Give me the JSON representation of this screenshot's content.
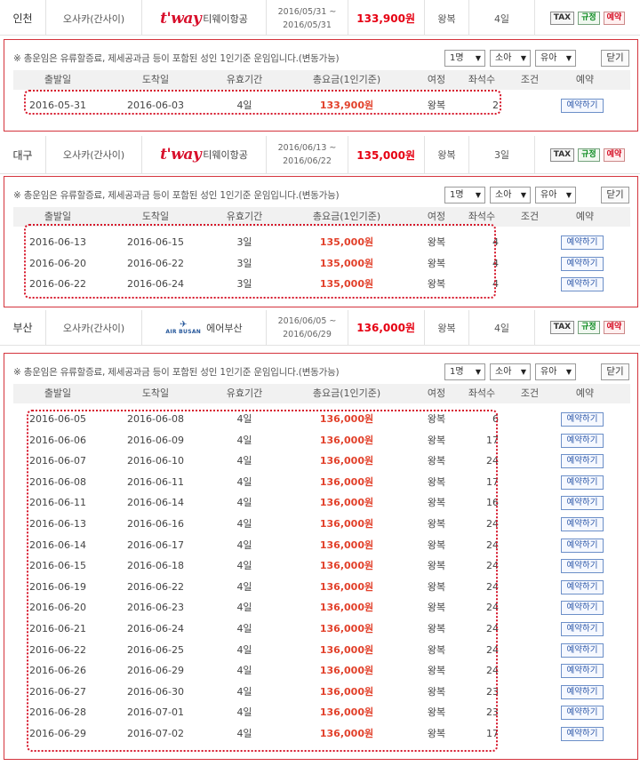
{
  "common": {
    "notice": "※ 총운임은 유류할증료, 제세공과금 등이 포함된 성인 1인기준 운임입니다.(변동가능)",
    "select_adult": "1명",
    "select_child": "소아",
    "select_infant": "유아",
    "close_label": "닫기",
    "headers": [
      "출발일",
      "도착일",
      "유효기간",
      "총요금(1인기준)",
      "여정",
      "좌석수",
      "조건",
      "예약"
    ],
    "reserve_label": "예약하기",
    "badge_tax": "TAX",
    "badge_rule": "규정",
    "badge_book": "예약",
    "select_arrow": "▼"
  },
  "groups": [
    {
      "summary": {
        "city": "인천",
        "destination": "오사카(간사이)",
        "logo_text": "t'way",
        "airline": "티웨이항공",
        "period_start": "2016/05/31 ~",
        "period_end": "2016/05/31",
        "price": "133,900원",
        "trip": "왕복",
        "stay": "4일"
      },
      "rows": [
        [
          "2016-05-31",
          "2016-06-03",
          "4일",
          "133,900원",
          "왕복",
          "2"
        ]
      ]
    },
    {
      "summary": {
        "city": "대구",
        "destination": "오사카(간사이)",
        "logo_text": "t'way",
        "airline": "티웨이항공",
        "period_start": "2016/06/13 ~",
        "period_end": "2016/06/22",
        "price": "135,000원",
        "trip": "왕복",
        "stay": "3일"
      },
      "rows": [
        [
          "2016-06-13",
          "2016-06-15",
          "3일",
          "135,000원",
          "왕복",
          "4"
        ],
        [
          "2016-06-20",
          "2016-06-22",
          "3일",
          "135,000원",
          "왕복",
          "4"
        ],
        [
          "2016-06-22",
          "2016-06-24",
          "3일",
          "135,000원",
          "왕복",
          "4"
        ]
      ]
    },
    {
      "summary": {
        "city": "부산",
        "destination": "오사카(간사이)",
        "logo_text": "AIR BUSAN",
        "airline": "에어부산",
        "period_start": "2016/06/05 ~",
        "period_end": "2016/06/29",
        "price": "136,000원",
        "trip": "왕복",
        "stay": "4일"
      },
      "rows": [
        [
          "2016-06-05",
          "2016-06-08",
          "4일",
          "136,000원",
          "왕복",
          "6"
        ],
        [
          "2016-06-06",
          "2016-06-09",
          "4일",
          "136,000원",
          "왕복",
          "17"
        ],
        [
          "2016-06-07",
          "2016-06-10",
          "4일",
          "136,000원",
          "왕복",
          "24"
        ],
        [
          "2016-06-08",
          "2016-06-11",
          "4일",
          "136,000원",
          "왕복",
          "17"
        ],
        [
          "2016-06-11",
          "2016-06-14",
          "4일",
          "136,000원",
          "왕복",
          "16"
        ],
        [
          "2016-06-13",
          "2016-06-16",
          "4일",
          "136,000원",
          "왕복",
          "24"
        ],
        [
          "2016-06-14",
          "2016-06-17",
          "4일",
          "136,000원",
          "왕복",
          "24"
        ],
        [
          "2016-06-15",
          "2016-06-18",
          "4일",
          "136,000원",
          "왕복",
          "24"
        ],
        [
          "2016-06-19",
          "2016-06-22",
          "4일",
          "136,000원",
          "왕복",
          "24"
        ],
        [
          "2016-06-20",
          "2016-06-23",
          "4일",
          "136,000원",
          "왕복",
          "24"
        ],
        [
          "2016-06-21",
          "2016-06-24",
          "4일",
          "136,000원",
          "왕복",
          "24"
        ],
        [
          "2016-06-22",
          "2016-06-25",
          "4일",
          "136,000원",
          "왕복",
          "24"
        ],
        [
          "2016-06-26",
          "2016-06-29",
          "4일",
          "136,000원",
          "왕복",
          "24"
        ],
        [
          "2016-06-27",
          "2016-06-30",
          "4일",
          "136,000원",
          "왕복",
          "23"
        ],
        [
          "2016-06-28",
          "2016-07-01",
          "4일",
          "136,000원",
          "왕복",
          "23"
        ],
        [
          "2016-06-29",
          "2016-07-02",
          "4일",
          "136,000원",
          "왕복",
          "17"
        ]
      ]
    }
  ]
}
